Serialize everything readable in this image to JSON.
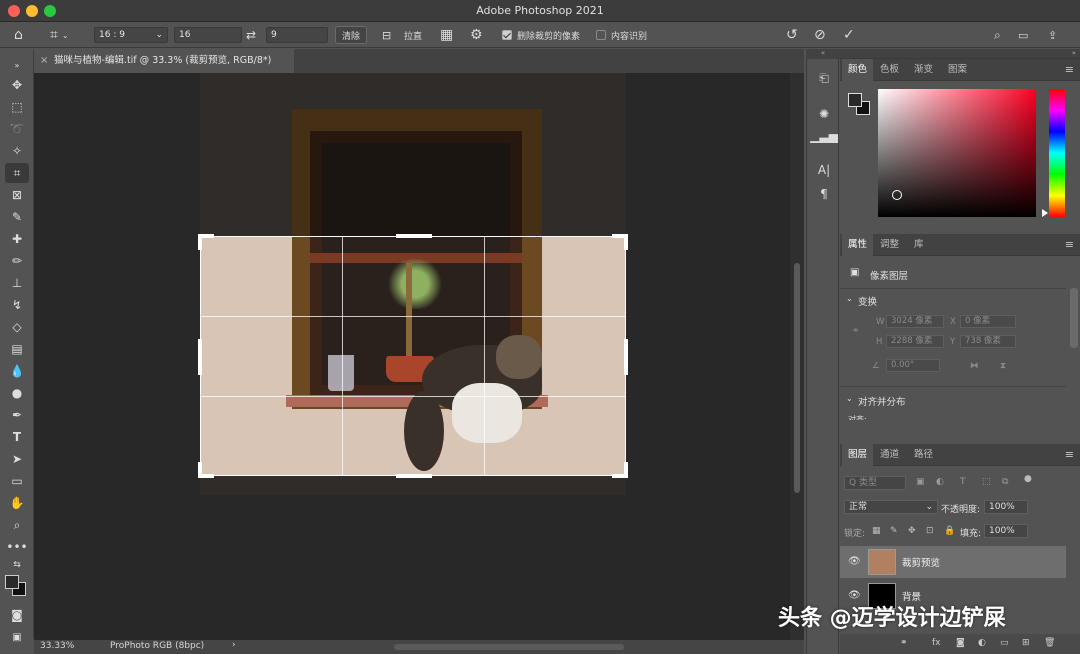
{
  "window": {
    "title": "Adobe Photoshop 2021"
  },
  "options": {
    "ratio": "16 : 9",
    "width": "16",
    "height": "9",
    "clear": "清除",
    "straighten": "拉直",
    "delete_cropped": "删除裁剪的像素",
    "content_aware": "内容识别"
  },
  "document": {
    "tab_title": "猫咪与植物-编辑.tif @ 33.3% (裁剪预览, RGB/8*)"
  },
  "status": {
    "zoom": "33.33%",
    "profile": "ProPhoto RGB (8bpc)"
  },
  "panels": {
    "color_tabs": [
      "颜色",
      "色板",
      "渐变",
      "图案"
    ],
    "props_tabs": [
      "属性",
      "调整",
      "库"
    ],
    "props_type": "像素图层",
    "transform_title": "变换",
    "w_label": "W",
    "w_value": "3024 像素",
    "x_label": "X",
    "x_value": "0 像素",
    "h_label": "H",
    "h_value": "2288 像素",
    "y_label": "Y",
    "y_value": "738 像素",
    "angle": "0.00°",
    "align_title": "对齐并分布",
    "align_sub": "对齐:",
    "layers_tabs": [
      "图层",
      "通道",
      "路径"
    ],
    "filter_kind": "Q 类型",
    "blend_mode": "正常",
    "opacity_label": "不透明度:",
    "opacity": "100%",
    "lock_label": "锁定:",
    "fill_label": "填充:",
    "fill": "100%",
    "layers": [
      {
        "name": "裁剪预览",
        "selected": true
      },
      {
        "name": "背景",
        "selected": false
      }
    ]
  },
  "watermark": "头条 @迈学设计边铲屎",
  "colors": {
    "accent": "#ff0022",
    "bg": "#535353",
    "canvas": "#282828"
  }
}
